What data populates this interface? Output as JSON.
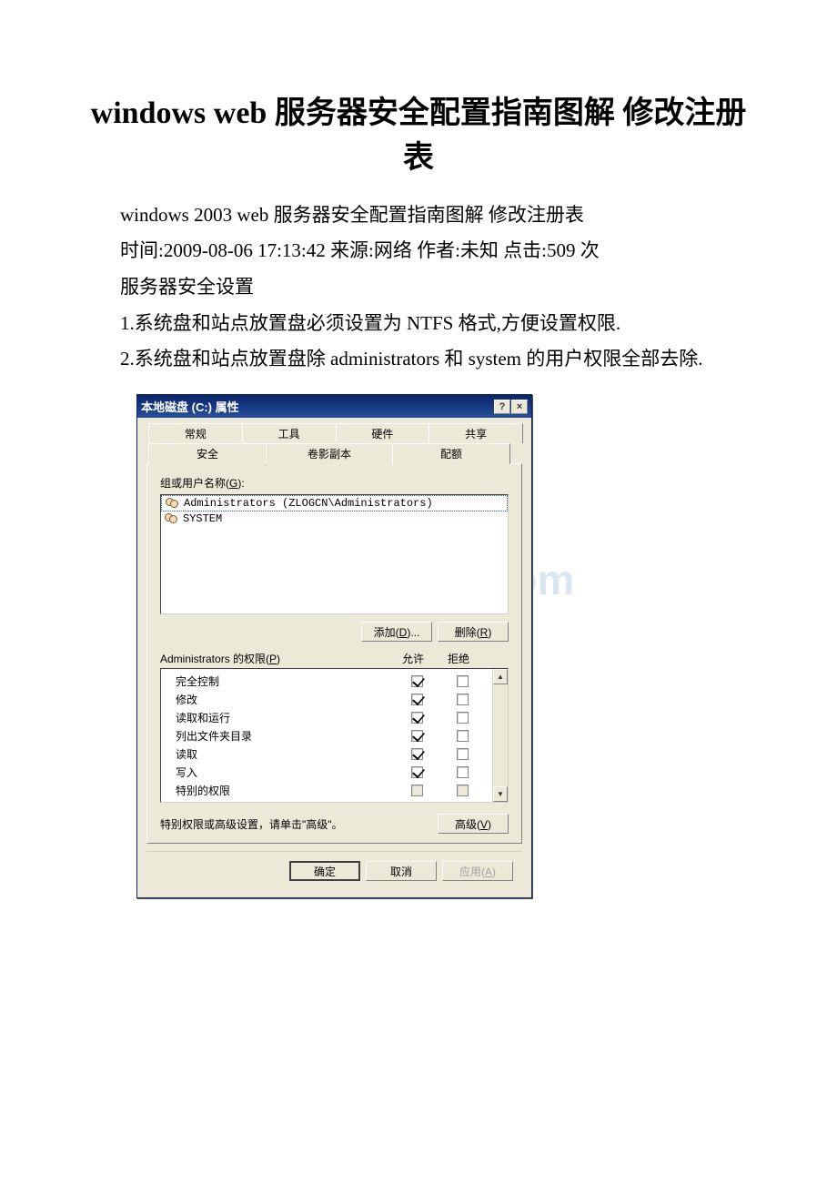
{
  "doc": {
    "title": "windows web 服务器安全配置指南图解 修改注册表",
    "p1": "windows 2003 web 服务器安全配置指南图解 修改注册表",
    "p2": "时间:2009-08-06 17:13:42 来源:网络 作者:未知 点击:509 次",
    "p3": "服务器安全设置",
    "p4": "1.系统盘和站点放置盘必须设置为 NTFS 格式,方便设置权限.",
    "p5": "2.系统盘和站点放置盘除 administrators 和 system 的用户权限全部去除."
  },
  "watermark": "www.bdocx.com",
  "dlg": {
    "title": "本地磁盘 (C:) 属性",
    "help_btn": "?",
    "close_btn": "×",
    "tabs_back": [
      "常规",
      "工具",
      "硬件",
      "共享"
    ],
    "tabs_front": [
      "安全",
      "卷影副本",
      "配额"
    ],
    "active_tab": "安全",
    "group_label_pre": "组或用户名称(",
    "group_label_u": "G",
    "group_label_post": "):",
    "users": [
      {
        "name": "Administrators (ZLOGCN\\Administrators)",
        "selected": true
      },
      {
        "name": "SYSTEM",
        "selected": false
      }
    ],
    "add_btn_pre": "添加(",
    "add_btn_u": "D",
    "add_btn_post": ")...",
    "remove_btn_pre": "删除(",
    "remove_btn_u": "R",
    "remove_btn_post": ")",
    "perm_label_pre": "Administrators 的权限(",
    "perm_label_u": "P",
    "perm_label_post": ")",
    "col_allow": "允许",
    "col_deny": "拒绝",
    "perms": [
      {
        "name": "完全控制",
        "allow": true,
        "deny": false
      },
      {
        "name": "修改",
        "allow": true,
        "deny": false
      },
      {
        "name": "读取和运行",
        "allow": true,
        "deny": false
      },
      {
        "name": "列出文件夹目录",
        "allow": true,
        "deny": false
      },
      {
        "name": "读取",
        "allow": true,
        "deny": false
      },
      {
        "name": "写入",
        "allow": true,
        "deny": false
      },
      {
        "name": "特别的权限",
        "allow": false,
        "deny": false,
        "disabled": true
      }
    ],
    "adv_text": "特别权限或高级设置，请单击\"高级\"。",
    "adv_btn_pre": "高级(",
    "adv_btn_u": "V",
    "adv_btn_post": ")",
    "ok_btn": "确定",
    "cancel_btn": "取消",
    "apply_btn_pre": "应用(",
    "apply_btn_u": "A",
    "apply_btn_post": ")"
  }
}
